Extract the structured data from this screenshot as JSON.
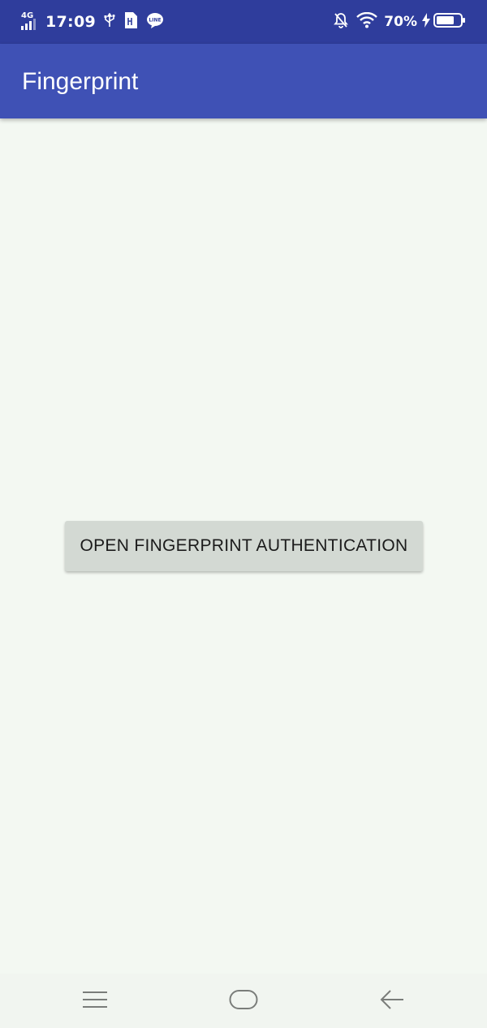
{
  "status_bar": {
    "network": "4G",
    "time": "17:09",
    "battery_percent": "70%",
    "icons": [
      "usb-icon",
      "storage-icon",
      "line-app-icon",
      "notifications-off-icon",
      "wifi-icon",
      "charging-icon",
      "battery-icon"
    ]
  },
  "app_bar": {
    "title": "Fingerprint",
    "color": "#3f51b5"
  },
  "main": {
    "auth_button_label": "OPEN FINGERPRINT AUTHENTICATION",
    "background": "#f3f8f2"
  },
  "nav_bar": {
    "icons": [
      "menu-icon",
      "home-icon",
      "back-icon"
    ]
  }
}
